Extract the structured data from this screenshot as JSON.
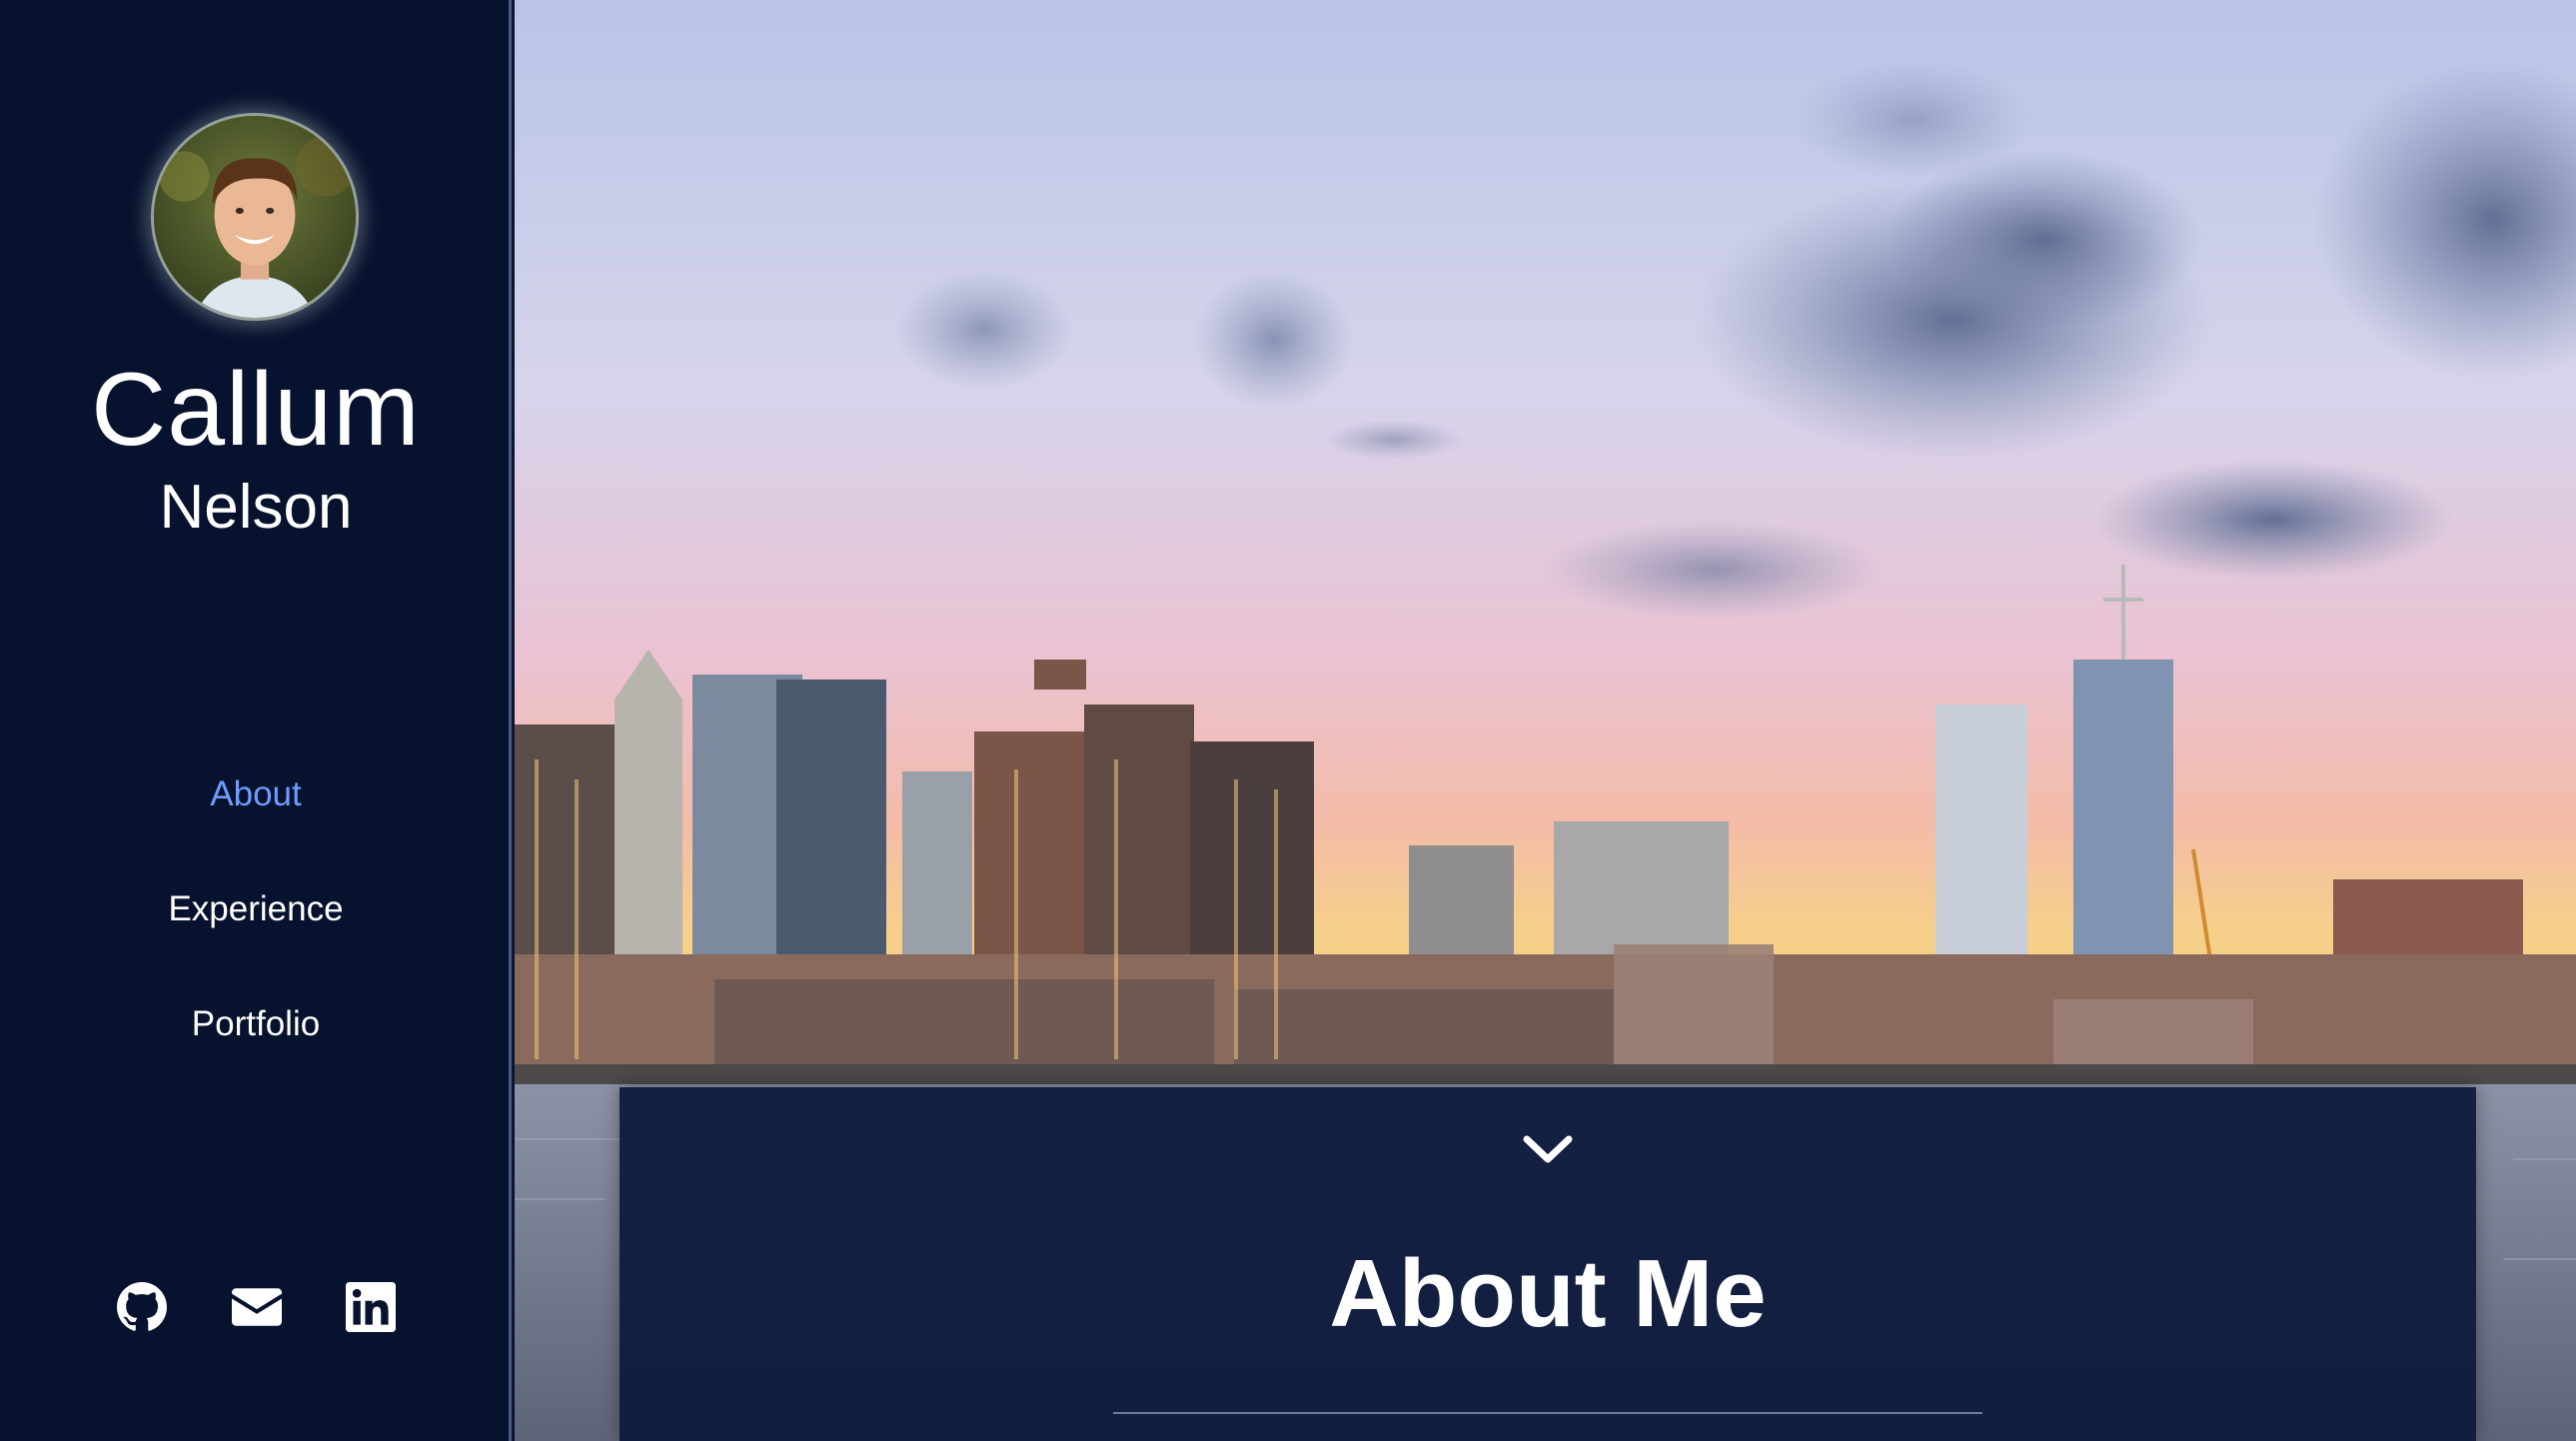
{
  "sidebar": {
    "avatar_alt": "profile photo",
    "name_first": "Callum",
    "name_last": "Nelson",
    "nav": [
      {
        "label": "About",
        "active": true
      },
      {
        "label": "Experience",
        "active": false
      },
      {
        "label": "Portfolio",
        "active": false
      }
    ],
    "socials": [
      {
        "icon": "github-icon"
      },
      {
        "icon": "envelope-icon"
      },
      {
        "icon": "linkedin-icon"
      }
    ]
  },
  "hero": {
    "background": "city-skyline-at-sunset"
  },
  "about": {
    "heading": "About Me",
    "scroll_icon": "chevron-down-icon"
  },
  "colors": {
    "sidebar_bg": "#07132e",
    "accent_active": "#6f9bff",
    "panel_bg": "#0e1a3c"
  }
}
